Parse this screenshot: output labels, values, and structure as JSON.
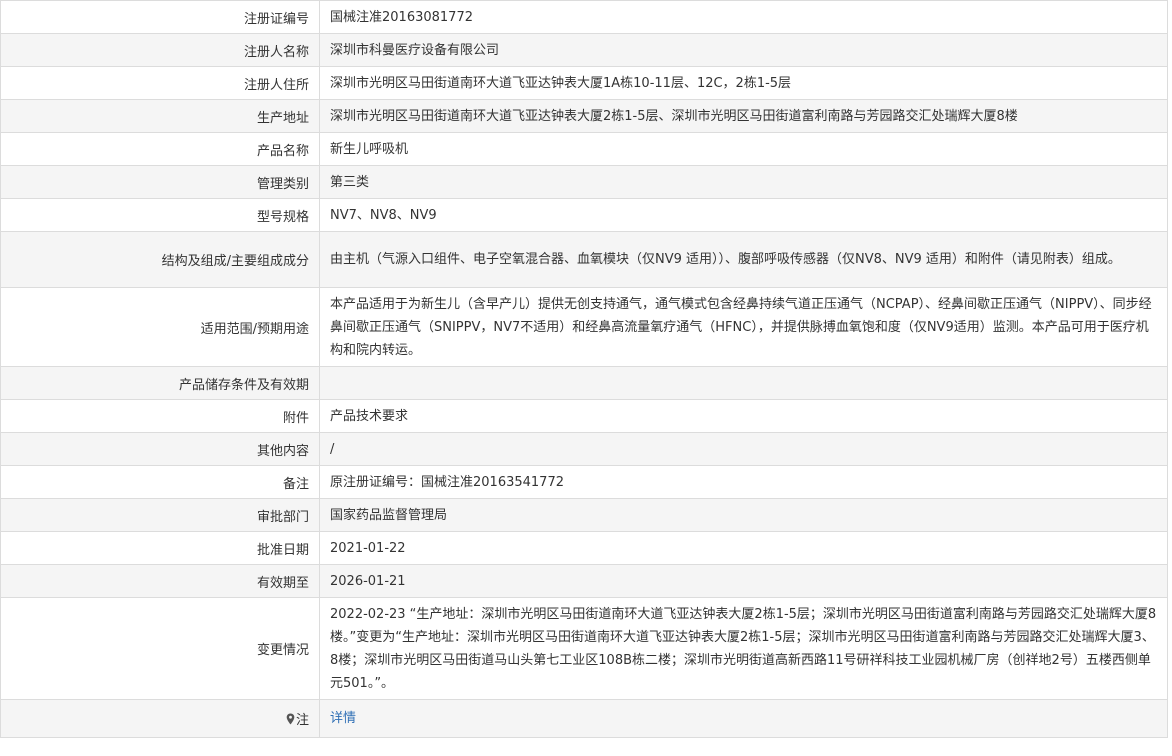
{
  "rows": [
    {
      "label": "注册证编号",
      "value": "国械注准20163081772"
    },
    {
      "label": "注册人名称",
      "value": "深圳市科曼医疗设备有限公司"
    },
    {
      "label": "注册人住所",
      "value": "深圳市光明区马田街道南环大道飞亚达钟表大厦1A栋10-11层、12C，2栋1-5层"
    },
    {
      "label": "生产地址",
      "value": "深圳市光明区马田街道南环大道飞亚达钟表大厦2栋1-5层、深圳市光明区马田街道富利南路与芳园路交汇处瑞辉大厦8楼"
    },
    {
      "label": "产品名称",
      "value": "新生儿呼吸机"
    },
    {
      "label": "管理类别",
      "value": "第三类"
    },
    {
      "label": "型号规格",
      "value": "NV7、NV8、NV9"
    },
    {
      "label": "结构及组成/主要组成成分",
      "value": "由主机（气源入口组件、电子空氧混合器、血氧模块（仅NV9 适用））、腹部呼吸传感器（仅NV8、NV9 适用）和附件（请见附表）组成。"
    },
    {
      "label": "适用范围/预期用途",
      "value": "本产品适用于为新生儿（含早产儿）提供无创支持通气，通气模式包含经鼻持续气道正压通气（NCPAP）、经鼻间歇正压通气（NIPPV）、同步经鼻间歇正压通气（SNIPPV，NV7不适用）和经鼻高流量氧疗通气（HFNC），并提供脉搏血氧饱和度（仅NV9适用）监测。本产品可用于医疗机构和院内转运。"
    },
    {
      "label": "产品储存条件及有效期",
      "value": ""
    },
    {
      "label": "附件",
      "value": "产品技术要求"
    },
    {
      "label": "其他内容",
      "value": "/"
    },
    {
      "label": "备注",
      "value": "原注册证编号：国械注准20163541772"
    },
    {
      "label": "审批部门",
      "value": "国家药品监督管理局"
    },
    {
      "label": "批准日期",
      "value": "2021-01-22"
    },
    {
      "label": "有效期至",
      "value": "2026-01-21"
    },
    {
      "label": "变更情况",
      "value": "2022-02-23 “生产地址：深圳市光明区马田街道南环大道飞亚达钟表大厦2栋1-5层；深圳市光明区马田街道富利南路与芳园路交汇处瑞辉大厦8楼。”变更为“生产地址：深圳市光明区马田街道南环大道飞亚达钟表大厦2栋1-5层；深圳市光明区马田街道富利南路与芳园路交汇处瑞辉大厦3、8楼；深圳市光明区马田街道马山头第七工业区108B栋二楼；深圳市光明街道高新西路11号研祥科技工业园机械厂房（创祥地2号）五楼西侧单元501。”。"
    }
  ],
  "note": {
    "label": "注",
    "icon": "location-pin-icon",
    "link": "详情",
    "link_color": "#2f6fb5"
  }
}
